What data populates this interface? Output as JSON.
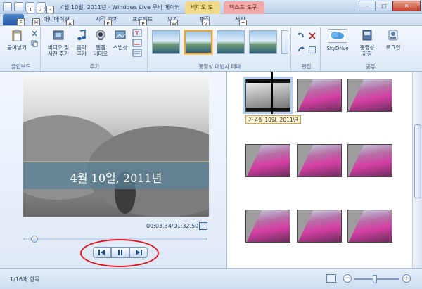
{
  "window": {
    "title": "4월 10일, 2011년 - Windows Live 무비 메이커",
    "context_video": "비디오 도구",
    "context_text": "텍스트 도구",
    "min": "–",
    "max": "□",
    "close": "✕"
  },
  "tabs": [
    "애니메이션",
    "시각 효과",
    "프로젝트",
    "보기",
    "편집",
    "서식"
  ],
  "keytips": [
    "F",
    "1",
    "2",
    "3",
    "H",
    "A",
    "E",
    "P",
    "W",
    "V",
    "T"
  ],
  "ribbon": {
    "clipboard": {
      "paste": "붙여넣기",
      "group": "클립보드"
    },
    "add": {
      "add_video": "비디오 및",
      "add_video2": "사진 추가",
      "add_music": "음악",
      "add_music2": "추가",
      "webcam": "웹캠",
      "webcam2": "비디오",
      "snapshot": "스냅샷",
      "group": "추가"
    },
    "themes": {
      "group": "동영상 마법사 테마"
    },
    "editing": {
      "group": "편집"
    },
    "share": {
      "skydrive": "SkyDrive",
      "save_movie": "동영상",
      "save_movie2": "저장",
      "signin": "로그인",
      "group": "공유"
    }
  },
  "preview": {
    "caption": "4월 10일, 2011년",
    "timecode": "00:03.34/01:32.50",
    "progress": 0.04
  },
  "storyboard": {
    "caption_chip": "가 4월 10일, 2011년"
  },
  "status": {
    "items": "1/16개 항목",
    "zoom_minus": "−",
    "zoom_plus": "+"
  }
}
